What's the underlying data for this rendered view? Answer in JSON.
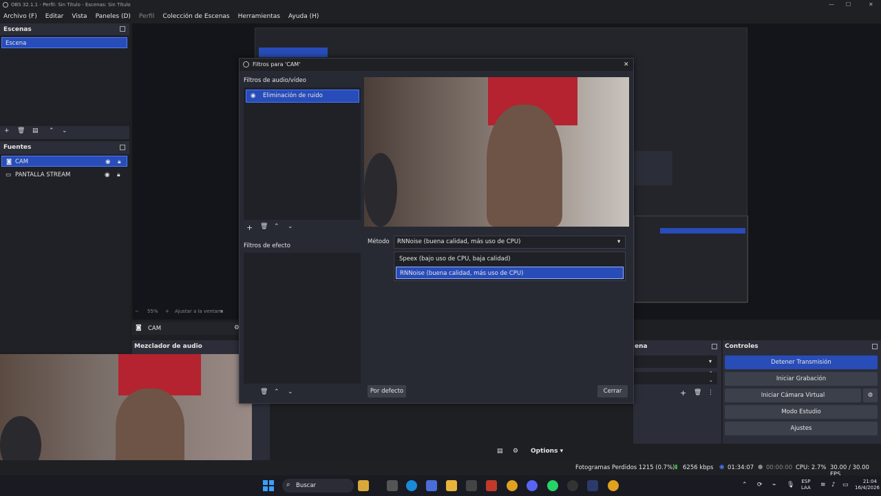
{
  "window": {
    "title": "OBS 32.1.1 - Perfil: Sin Título - Escenas: Sin Título"
  },
  "menu": [
    "Archivo (F)",
    "Editar",
    "Vista",
    "Paneles (D)",
    "Perfil",
    "Colección de Escenas",
    "Herramientas",
    "Ayuda (H)"
  ],
  "scenes": {
    "title": "Escenas",
    "items": [
      "Escena"
    ]
  },
  "sources": {
    "title": "Fuentes",
    "items": [
      "CAM",
      "PANTALLA STREAM"
    ]
  },
  "preview": {
    "zoom": "55%",
    "fit": "Ajustar a la ventana",
    "source_label": "CAM"
  },
  "mixer": {
    "title": "Mezclador de audio"
  },
  "transitions": {
    "title": "ena"
  },
  "controls": {
    "title": "Controles",
    "buttons": [
      "Detener Transmisión",
      "Iniciar Grabación",
      "Iniciar Cámara Virtual",
      "Modo Estudio",
      "Ajustes"
    ]
  },
  "dialog": {
    "title": "Filtros para 'CAM'",
    "av_filters_label": "Filtros de audio/vídeo",
    "av_filters": [
      "Eliminación de ruido"
    ],
    "effect_filters_label": "Filtros de efecto",
    "method_label": "Método",
    "method_value": "RNNoise (buena calidad, más uso de CPU)",
    "method_options": [
      "Speex (bajo uso de CPU, baja calidad)",
      "RNNoise (buena calidad, más uso de CPU)"
    ],
    "defaults_button": "Por defecto",
    "close_button": "Cerrar"
  },
  "options_button": "Options",
  "status": {
    "dropped": "Fotogramas Perdidos 1215 (0.7%)",
    "bitrate": "6256 kbps",
    "live_time": "01:34:07",
    "rec_time": "00:00:00",
    "cpu": "CPU: 2.7%",
    "fps": "30.00 / 30.00 FPS"
  },
  "taskbar": {
    "search": "Buscar",
    "lang1": "ESP",
    "lang2": "LAA",
    "time": "21:04",
    "date": "16/4/2026"
  },
  "colors": {
    "accent": "#284cb8",
    "bg": "#1e1f22",
    "panel": "#2b2e38"
  }
}
